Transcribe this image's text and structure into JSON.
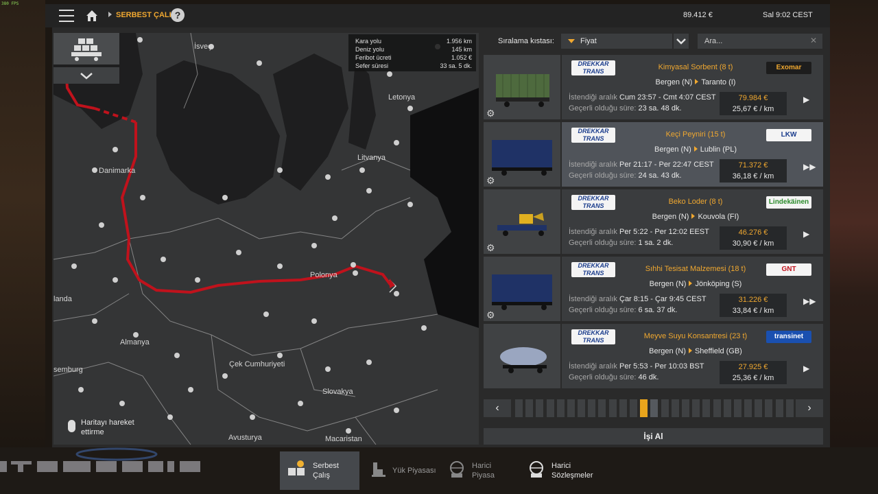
{
  "fps_text": "380 FPS",
  "header": {
    "breadcrumb": "SERBEST ÇALIŞ",
    "help_label": "?",
    "money": "89.412 €",
    "clock": "Sal 9:02 CEST"
  },
  "route_info": {
    "rows": [
      {
        "label": "Kara yolu",
        "value": "1.956 km"
      },
      {
        "label": "Deniz yolu",
        "value": "145 km"
      },
      {
        "label": "Feribot ücreti",
        "value": "1.052 €"
      },
      {
        "label": "Sefer süresi",
        "value": "33 sa. 5 dk."
      }
    ]
  },
  "map": {
    "labels": [
      "İsveç",
      "Letonya",
      "Danimarka",
      "Litvanya",
      "Polonya",
      "landa",
      "Almanya",
      "semburg",
      "Çek Cumhuriyeti",
      "Slovakya",
      "Avusturya",
      "Macaristan"
    ],
    "hint": "Haritayı hareket ettirme"
  },
  "sort": {
    "label": "Sıralama kıstası:",
    "selected": "Fiyat",
    "search_placeholder": "Ara..."
  },
  "jobs": [
    {
      "company": "DREKKAR TRANS",
      "cargo": "Kimyasal Sorbent (8 t)",
      "from": "Bergen (N)",
      "to": "Taranto (I)",
      "range_label": "İstendiği aralık",
      "range": "Cum 23:57 - Cmt 4:07 CEST",
      "valid_label": "Geçerli olduğu süre:",
      "valid": "23 sa. 48 dk.",
      "price": "79.984 €",
      "per_km": "25,67 € / km",
      "logo": "Exomar",
      "icon": "single-chevron-icon"
    },
    {
      "company": "DREKKAR TRANS",
      "cargo": "Keçi Peyniri (15 t)",
      "from": "Bergen (N)",
      "to": "Lublin (PL)",
      "range_label": "İstendiği aralık",
      "range": "Per 21:17 - Per 22:47 CEST",
      "valid_label": "Geçerli olduğu süre:",
      "valid": "24 sa. 43 dk.",
      "price": "71.372 €",
      "per_km": "36,18 € / km",
      "logo": "LKW",
      "icon": "double-chevron-icon"
    },
    {
      "company": "DREKKAR TRANS",
      "cargo": "Beko Loder (8 t)",
      "from": "Bergen (N)",
      "to": "Kouvola (FI)",
      "range_label": "İstendiği aralık",
      "range": "Per 5:22 - Per 12:02 EEST",
      "valid_label": "Geçerli olduğu süre:",
      "valid": "1 sa. 2 dk.",
      "price": "46.276 €",
      "per_km": "30,90 € / km",
      "logo": "Lindekäinen",
      "icon": "single-chevron-icon"
    },
    {
      "company": "DREKKAR TRANS",
      "cargo": "Sıhhi Tesisat Malzemesi (18 t)",
      "from": "Bergen (N)",
      "to": "Jönköping (S)",
      "range_label": "İstendiği aralık",
      "range": "Çar 8:15 - Çar 9:45 CEST",
      "valid_label": "Geçerli olduğu süre:",
      "valid": "6 sa. 37 dk.",
      "price": "31.226 €",
      "per_km": "33,84 € / km",
      "logo": "GNT",
      "icon": "double-chevron-icon"
    },
    {
      "company": "DREKKAR TRANS",
      "cargo": "Meyve Suyu Konsantresi (23 t)",
      "from": "Bergen (N)",
      "to": "Sheffield (GB)",
      "range_label": "İstendiği aralık",
      "range": "Per 5:53 - Per 10:03 BST",
      "valid_label": "Geçerli olduğu süre:",
      "valid": "46 dk.",
      "price": "27.925 €",
      "per_km": "25,36 € / km",
      "logo": "transinet",
      "icon": "single-chevron-icon"
    }
  ],
  "pager": {
    "prev": "‹",
    "next": "›",
    "page_count": 27,
    "current_page": 13
  },
  "take_job": "İşi Al",
  "tabs": [
    {
      "label": "Serbest Çalış",
      "active": true
    },
    {
      "label": "Yük Piyasası",
      "active": false
    },
    {
      "label": "Harici Piyasa",
      "active": false
    },
    {
      "label": "Harici Sözleşmeler",
      "active": false
    }
  ],
  "colors": {
    "accent": "#f0a830",
    "route": "#c0121c",
    "panel": "#2a2a2a"
  }
}
